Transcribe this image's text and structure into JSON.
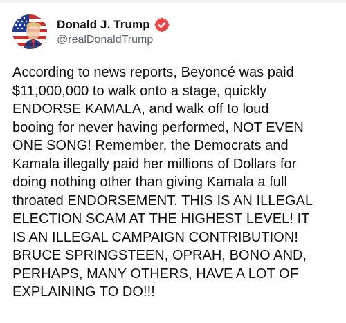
{
  "post": {
    "author": {
      "display_name": "Donald J. Trump",
      "handle": "@realDonaldTrump",
      "avatar_icon": "american-flag-portrait-avatar",
      "verified_icon": "verified-badge-icon",
      "verified_color": "#e8474a"
    },
    "text": "According to news reports, Beyoncé was paid\n$11,000,000 to walk onto a stage, quickly\nENDORSE KAMALA, and walk off to loud\nbooing for never having performed, NOT EVEN\nONE SONG! Remember, the Democrats and\nKamala illegally paid her millions of Dollars for\ndoing nothing other than giving Kamala a full\nthroated ENDORSEMENT. THIS IS AN ILLEGAL\nELECTION SCAM AT THE HIGHEST LEVEL! IT\nIS AN ILLEGAL CAMPAIGN CONTRIBUTION!\nBRUCE SPRINGSTEEN, OPRAH, BONO AND,\nPERHAPS, MANY OTHERS, HAVE A LOT OF\nEXPLAINING TO DO!!!"
  }
}
